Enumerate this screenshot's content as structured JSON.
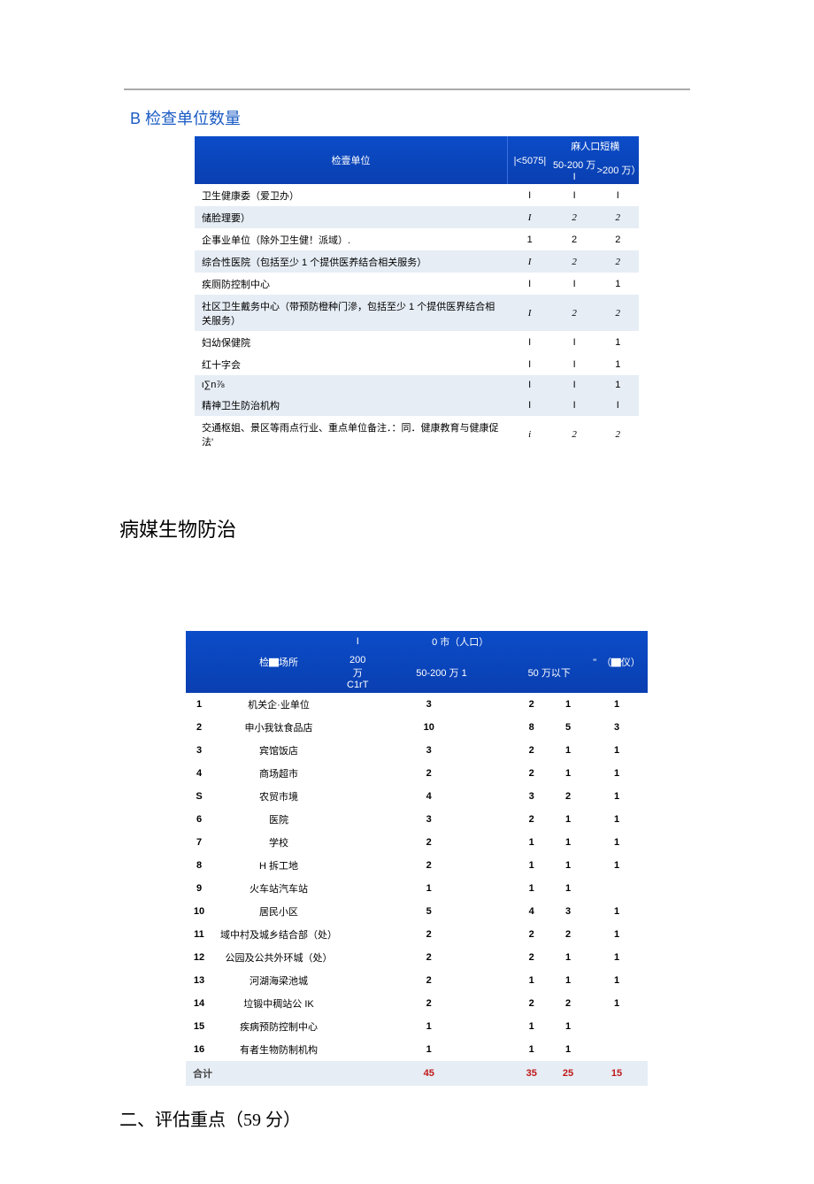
{
  "sectionB": {
    "prefix": "B",
    "title": "检查单位数量"
  },
  "table1": {
    "header": {
      "col1": "检壹单位",
      "group": "麻人口短横",
      "sub": [
        "|<5075|",
        "50-200 万 I",
        ">200 万）"
      ]
    },
    "rows": [
      {
        "label": "卫生健康委（爱卫办）",
        "c1": "I",
        "c2": "I",
        "c3": "I",
        "italic": false
      },
      {
        "label": "储脸理要）",
        "c1": "I",
        "c2": "2",
        "c3": "2",
        "italic": true
      },
      {
        "label": "企事业单位（除外卫生健！派域）.",
        "c1": "1",
        "c2": "2",
        "c3": "2",
        "italic": false
      },
      {
        "label": "综合性医院（包括至少 1 个提供医养结合相关服务）",
        "c1": "I",
        "c2": "2",
        "c3": "2",
        "italic": true
      },
      {
        "label": "疾厕防控制中心",
        "c1": "I",
        "c2": "I",
        "c3": "1",
        "italic": false
      },
      {
        "label": "社区卫生戴务中心（带预防橙种门滲，包括至少 1 个提供医界结合相关服务）",
        "c1": "I",
        "c2": "2",
        "c3": "2",
        "italic": true
      },
      {
        "label": "妇幼保健院",
        "c1": "I",
        "c2": "I",
        "c3": "1",
        "italic": false
      },
      {
        "label": "红十字会",
        "c1": "I",
        "c2": "I",
        "c3": "1",
        "italic": false
      },
      {
        "label": "ι∑n⅞",
        "c1": "I",
        "c2": "I",
        "c3": "1",
        "italic": false
      },
      {
        "label": "精神卫生防治机构",
        "c1": "I",
        "c2": "I",
        "c3": "I",
        "italic": false
      },
      {
        "label": "交通枢姐、景区等雨点行业、重点单位备注．：同．健康教育与健康促法'",
        "c1": "i",
        "c2": "2",
        "c3": "2",
        "italic": true
      }
    ]
  },
  "heading2": "病媒生物防治",
  "table2": {
    "header": {
      "place": "检▇场所",
      "group": "0 市（人口）",
      "tickCol": "I",
      "quoteCol": "\"　（▇仪）",
      "sub": [
        "200 万 C1rT",
        "50-200 万 1",
        "50 万以下"
      ]
    },
    "rows": [
      {
        "no": "1",
        "place": "机关企·业单位",
        "c1": "3",
        "c2": "2",
        "c3": "1",
        "c4": "1"
      },
      {
        "no": "2",
        "place": "申小我钛食品店",
        "c1": "10",
        "c2": "8",
        "c3": "5",
        "c4": "3"
      },
      {
        "no": "3",
        "place": "宾馆饭店",
        "c1": "3",
        "c2": "2",
        "c3": "1",
        "c4": "1"
      },
      {
        "no": "4",
        "place": "商场超市",
        "c1": "2",
        "c2": "2",
        "c3": "1",
        "c4": "1"
      },
      {
        "no": "S",
        "place": "农贸市境",
        "c1": "4",
        "c2": "3",
        "c3": "2",
        "c4": "1"
      },
      {
        "no": "6",
        "place": "医院",
        "c1": "3",
        "c2": "2",
        "c3": "1",
        "c4": "1"
      },
      {
        "no": "7",
        "place": "学校",
        "c1": "2",
        "c2": "1",
        "c3": "1",
        "c4": "1"
      },
      {
        "no": "8",
        "place": "H 拆工地",
        "c1": "2",
        "c2": "1",
        "c3": "1",
        "c4": "1"
      },
      {
        "no": "9",
        "place": "火车站汽车站",
        "c1": "1",
        "c2": "1",
        "c3": "1",
        "c4": ""
      },
      {
        "no": "10",
        "place": "居民小区",
        "c1": "5",
        "c2": "4",
        "c3": "3",
        "c4": "1"
      },
      {
        "no": "11",
        "place": "域中村及城乡结合部（处）",
        "c1": "2",
        "c2": "2",
        "c3": "2",
        "c4": "1"
      },
      {
        "no": "12",
        "place": "公园及公共外环城（处）",
        "c1": "2",
        "c2": "2",
        "c3": "1",
        "c4": "1"
      },
      {
        "no": "13",
        "place": "河湖海梁池城",
        "c1": "2",
        "c2": "1",
        "c3": "1",
        "c4": "1"
      },
      {
        "no": "14",
        "place": "垃锻中稠站公 IK",
        "c1": "2",
        "c2": "2",
        "c3": "2",
        "c4": "1"
      },
      {
        "no": "15",
        "place": "疾病预防控制中心",
        "c1": "1",
        "c2": "1",
        "c3": "1",
        "c4": ""
      },
      {
        "no": "16",
        "place": "有者生物防制机构",
        "c1": "1",
        "c2": "1",
        "c3": "1",
        "c4": ""
      }
    ],
    "footer": {
      "label": "合计",
      "c1": "45",
      "c2": "35",
      "c3": "25",
      "c4": "15"
    }
  },
  "heading3": "二、评估重点（59 分）"
}
